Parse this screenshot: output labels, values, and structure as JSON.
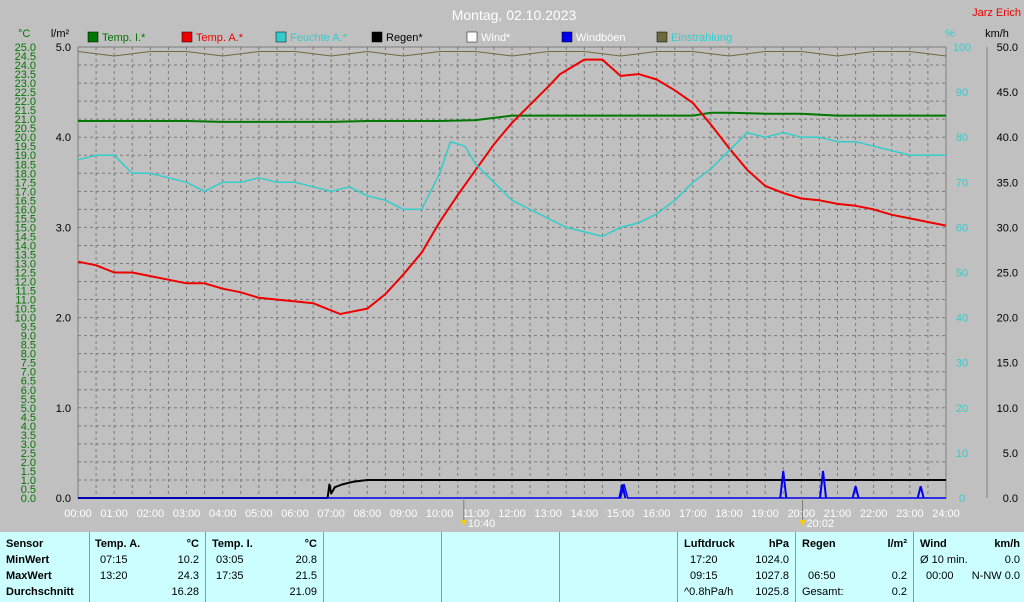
{
  "title": "Montag, 02.10.2023",
  "author": "Jarz Erich",
  "units": {
    "temp": "°C",
    "rain": "l/m²",
    "humidity": "%",
    "wind": "km/h"
  },
  "legend": [
    {
      "name": "Temp. I.*",
      "color": "#007700"
    },
    {
      "name": "Temp. A.*",
      "color": "#ee0000"
    },
    {
      "name": "Feuchte A.*",
      "color": "#33cccc"
    },
    {
      "name": "Regen*",
      "color": "#000000"
    },
    {
      "name": "Wind*",
      "color": "#ffffff"
    },
    {
      "name": "Windböen",
      "color": "#0000ee"
    },
    {
      "name": "Einstrahlung",
      "color": "#6b6b3b"
    }
  ],
  "markers": [
    {
      "time": "10:40",
      "label": "10:40"
    },
    {
      "time": "20:02",
      "label": "20:02"
    }
  ],
  "chart_data": {
    "type": "line",
    "x_ticks": [
      "00:00",
      "01:00",
      "02:00",
      "03:00",
      "04:00",
      "05:00",
      "06:00",
      "07:00",
      "08:00",
      "09:00",
      "10:00",
      "11:00",
      "12:00",
      "13:00",
      "14:00",
      "15:00",
      "16:00",
      "17:00",
      "18:00",
      "19:00",
      "20:00",
      "21:00",
      "22:00",
      "23:00",
      "24:00"
    ],
    "axes": {
      "temp": {
        "ylim": [
          0,
          25
        ],
        "ticks": [
          "0.0",
          "0.5",
          "1.0",
          "1.5",
          "2.0",
          "2.5",
          "3.0",
          "3.5",
          "4.0",
          "4.5",
          "5.0",
          "5.5",
          "6.0",
          "6.5",
          "7.0",
          "7.5",
          "8.0",
          "8.5",
          "9.0",
          "9.5",
          "10.0",
          "10.5",
          "11.0",
          "11.5",
          "12.0",
          "12.5",
          "13.0",
          "13.5",
          "14.0",
          "14.5",
          "15.0",
          "15.5",
          "16.0",
          "16.5",
          "17.0",
          "17.5",
          "18.0",
          "18.5",
          "19.0",
          "19.5",
          "20.0",
          "20.5",
          "21.0",
          "21.5",
          "22.0",
          "22.5",
          "23.0",
          "23.5",
          "24.0",
          "24.5",
          "25.0"
        ],
        "color": "#007700"
      },
      "rain": {
        "ylim": [
          0,
          5
        ],
        "ticks": [
          "0.0",
          "1.0",
          "2.0",
          "3.0",
          "4.0",
          "5.0"
        ],
        "color": "#000000"
      },
      "humidity": {
        "ylim": [
          0,
          100
        ],
        "ticks": [
          "0",
          "10",
          "20",
          "30",
          "40",
          "50",
          "60",
          "70",
          "80",
          "90",
          "100"
        ],
        "color": "#33cccc"
      },
      "wind": {
        "ylim": [
          0,
          50
        ],
        "ticks": [
          "0.0",
          "5.0",
          "10.0",
          "15.0",
          "20.0",
          "25.0",
          "30.0",
          "35.0",
          "40.0",
          "45.0",
          "50.0"
        ],
        "color": "#000000"
      }
    },
    "series": [
      {
        "name": "Temp. I.*",
        "axis": "temp",
        "color": "#007700",
        "x": [
          0,
          1,
          2,
          3,
          4,
          5,
          6,
          7,
          8,
          9,
          10,
          11,
          12,
          13,
          14,
          15,
          16,
          17,
          17.5,
          18,
          19,
          20,
          21,
          22,
          23,
          24
        ],
        "y": [
          20.9,
          20.9,
          20.9,
          20.9,
          20.85,
          20.85,
          20.85,
          20.85,
          20.9,
          20.9,
          20.9,
          20.95,
          21.2,
          21.2,
          21.2,
          21.2,
          21.2,
          21.2,
          21.35,
          21.35,
          21.3,
          21.3,
          21.2,
          21.2,
          21.2,
          21.2
        ]
      },
      {
        "name": "Temp. A.*",
        "axis": "temp",
        "color": "#ee0000",
        "x": [
          0,
          0.5,
          1,
          1.5,
          2,
          2.5,
          3,
          3.5,
          4,
          4.5,
          5,
          5.5,
          6,
          6.5,
          7,
          7.25,
          7.5,
          8,
          8.5,
          9,
          9.5,
          10,
          10.5,
          11,
          11.5,
          12,
          12.5,
          13,
          13.33,
          14,
          14.5,
          15,
          15.5,
          16,
          16.5,
          17,
          17.5,
          18,
          18.5,
          19,
          19.5,
          20,
          20.5,
          21,
          21.5,
          22,
          22.5,
          23,
          23.5,
          24
        ],
        "y": [
          13.1,
          12.9,
          12.5,
          12.5,
          12.3,
          12.1,
          11.9,
          11.9,
          11.6,
          11.4,
          11.1,
          11.0,
          10.9,
          10.8,
          10.4,
          10.2,
          10.3,
          10.5,
          11.3,
          12.4,
          13.6,
          15.3,
          16.8,
          18.2,
          19.6,
          20.8,
          21.8,
          22.8,
          23.5,
          24.3,
          24.3,
          23.4,
          23.5,
          23.2,
          22.6,
          21.9,
          20.7,
          19.4,
          18.2,
          17.3,
          16.9,
          16.6,
          16.5,
          16.3,
          16.2,
          16.0,
          15.7,
          15.5,
          15.3,
          15.1
        ]
      },
      {
        "name": "Feuchte A.*",
        "axis": "humidity",
        "color": "#33cccc",
        "x": [
          0,
          0.5,
          1,
          1.25,
          1.5,
          2,
          2.5,
          3,
          3.5,
          4,
          4.5,
          5,
          5.5,
          6,
          6.5,
          7,
          7.5,
          8,
          8.5,
          9,
          9.5,
          10,
          10.3,
          10.7,
          11,
          11.5,
          12,
          12.5,
          13,
          13.5,
          14,
          14.5,
          15,
          15.5,
          16,
          16.5,
          17,
          17.5,
          18,
          18.5,
          19,
          19.5,
          20,
          20.5,
          21,
          21.5,
          22,
          22.5,
          23,
          23.5,
          24
        ],
        "y": [
          75,
          76,
          76,
          74,
          72,
          72,
          71,
          70,
          68,
          70,
          70,
          71,
          70,
          70,
          69,
          68,
          69,
          67,
          66,
          64,
          64,
          72,
          79,
          78,
          74,
          70,
          66,
          64,
          62,
          60,
          59,
          58,
          60,
          61,
          63,
          66,
          70,
          73,
          77,
          81,
          80,
          81,
          80,
          80,
          79,
          79,
          78,
          77,
          76,
          76,
          76
        ]
      },
      {
        "name": "Regen*",
        "axis": "rain",
        "color": "#000000",
        "x": [
          0,
          6.9,
          6.95,
          7.0,
          7.1,
          7.3,
          7.6,
          8.0,
          24
        ],
        "y": [
          0,
          0,
          0.15,
          0.05,
          0.12,
          0.15,
          0.18,
          0.2,
          0.2
        ]
      },
      {
        "name": "Windböen",
        "axis": "wind",
        "color": "#0000ee",
        "x": [
          0,
          15.0,
          15.1,
          15.2,
          24
        ],
        "y": [
          0,
          0,
          1.5,
          0,
          0
        ]
      },
      {
        "name": "Einstrahlung",
        "axis": "humidity",
        "color": "#6b6b3b",
        "x": [
          0,
          1,
          2,
          3,
          4,
          5,
          6,
          7,
          8,
          9,
          10,
          11,
          12,
          13,
          14,
          15,
          16,
          17,
          18,
          19,
          20,
          21,
          22,
          23,
          24
        ],
        "y": [
          99,
          98,
          99,
          99,
          98,
          99,
          99,
          98,
          99,
          98,
          99,
          99,
          98,
          99,
          99,
          98,
          99,
          99,
          98,
          99,
          99,
          98,
          99,
          99,
          98
        ]
      }
    ],
    "gust_events": [
      {
        "x": 15.05,
        "y": 1.5
      },
      {
        "x": 19.5,
        "y": 3.0
      },
      {
        "x": 20.6,
        "y": 3.0
      },
      {
        "x": 21.5,
        "y": 1.3
      },
      {
        "x": 23.3,
        "y": 1.3
      }
    ]
  },
  "stats": {
    "sensor": {
      "header": "Sensor",
      "rows": [
        "MinWert",
        "MaxWert",
        "Durchschnitt"
      ]
    },
    "temp_a": {
      "header": "Temp. A.",
      "unit": "°C",
      "rows": [
        [
          "07:15",
          "10.2"
        ],
        [
          "13:20",
          "24.3"
        ],
        [
          "",
          "16.28"
        ]
      ]
    },
    "temp_i": {
      "header": "Temp. I.",
      "unit": "°C",
      "rows": [
        [
          "03:05",
          "20.8"
        ],
        [
          "17:35",
          "21.5"
        ],
        [
          "",
          "21.09"
        ]
      ]
    },
    "pressure": {
      "header": "Luftdruck",
      "unit": "hPa",
      "rows": [
        [
          "17:20",
          "1024.0"
        ],
        [
          "09:15",
          "1027.8"
        ],
        [
          "^0.8hPa/h",
          "1025.8"
        ]
      ]
    },
    "rain": {
      "header": "Regen",
      "unit": "l/m²",
      "rows": [
        [
          "",
          ""
        ],
        [
          "06:50",
          "0.2"
        ],
        [
          "Gesamt:",
          "0.2"
        ]
      ]
    },
    "wind": {
      "header": "Wind",
      "unit": "km/h",
      "rows": [
        [
          "Ø 10 min.",
          "0.0"
        ],
        [
          "00:00",
          "N-NW 0.0"
        ],
        [
          "",
          ""
        ]
      ]
    }
  }
}
